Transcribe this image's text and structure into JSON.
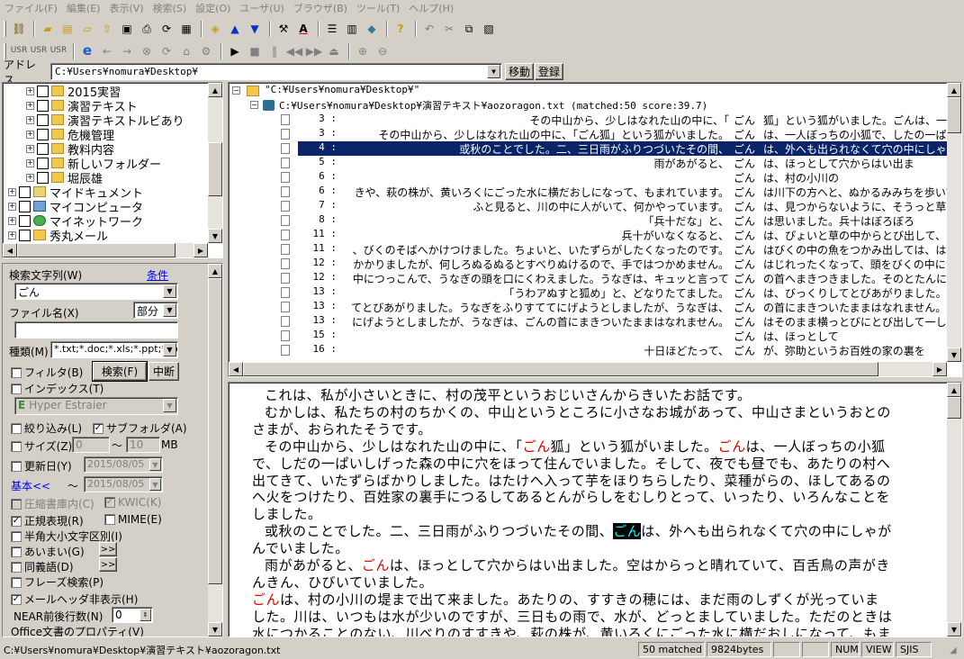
{
  "menu": [
    "ファイル(F)",
    "編集(E)",
    "表示(V)",
    "検索(S)",
    "設定(O)",
    "ユーザ(U)",
    "ブラウザ(B)",
    "ツール(T)",
    "ヘルプ(H)"
  ],
  "address": {
    "label": "アドレス",
    "value": "C:¥Users¥nomura¥Desktop¥",
    "move_label": "移動",
    "register_label": "登録"
  },
  "tree": {
    "items": [
      {
        "label": "2015実習",
        "level": 2
      },
      {
        "label": "演習テキスト",
        "level": 2
      },
      {
        "label": "演習テキストルビあり",
        "level": 2
      },
      {
        "label": "危機管理",
        "level": 2
      },
      {
        "label": "教料内容",
        "level": 2
      },
      {
        "label": "新しいフォルダー",
        "level": 2
      },
      {
        "label": "堀辰雄",
        "level": 2
      },
      {
        "label": "マイドキュメント",
        "level": 1
      },
      {
        "label": "マイコンピュータ",
        "level": 1
      },
      {
        "label": "マイネットワーク",
        "level": 1
      },
      {
        "label": "秀丸メール",
        "level": 1
      }
    ]
  },
  "search": {
    "query_label": "検索文字列(W)",
    "condition_link": "条件",
    "query_value": "ごん",
    "filename_label": "ファイル名(X)",
    "filename_mode": "部分",
    "filename_value": "",
    "type_label": "種類(M)",
    "type_value": "*.txt;*.doc;*.xls;*.ppt;*.doc",
    "filter_label": "フィルタ(B)",
    "search_button": "検索(F)",
    "stop_button": "中断",
    "index_label": "インデックス(T)",
    "engine_value": "Hyper Estraier",
    "narrow_label": "絞り込み(L)",
    "subfolder_label": "サブフォルダ(A)",
    "size_label": "サイズ(Z)",
    "size_min": "0",
    "size_tilde": "～",
    "size_max": "10",
    "size_unit": "MB",
    "date_label": "更新日(Y)",
    "date_from": "2015/08/05",
    "basic_link": "基本<<",
    "date_tilde": "～",
    "date_to": "2015/08/05",
    "archive_label": "圧縮書庫内(C)",
    "kwic_label": "KWIC(K)",
    "regex_label": "正規表現(R)",
    "mime_label": "MIME(E)",
    "halfwidth_label": "半角大小文字区別(I)",
    "fuzzy_label": "あいまい(G)",
    "synonym_label": "同義語(D)",
    "phrase_label": "フレーズ検索(P)",
    "mailhdr_label": "メールヘッダ非表示(H)",
    "near_label": "NEAR前後行数(N)",
    "near_value": "0",
    "office_label": "Office文書のプロパティ(V)",
    "more_button": ">>"
  },
  "results": {
    "root": "\"C:¥Users¥nomura¥Desktop¥\"",
    "file": "C:¥Users¥nomura¥Desktop¥演習テキスト¥aozoragon.txt (matched:50 score:39.7)",
    "rows": [
      {
        "num": "3 :",
        "before": "その中山から、少しはなれた山の中に、「",
        "kw": "ごん",
        "after": "狐」という狐がいました。ごんは、一人ぼ"
      },
      {
        "num": "3 :",
        "before": "その中山から、少しはなれた山の中に、「ごん狐」という狐がいました。",
        "kw": "ごん",
        "after": "は、一人ぼっちの小狐で、したの一ぱい"
      },
      {
        "num": "4 :",
        "before": "或秋のことでした。二、三日雨がふりつづいたその間、",
        "kw": "ごん",
        "after": "は、外へも出られなくて穴の中にしゃがん"
      },
      {
        "num": "5 :",
        "before": "雨があがると、",
        "kw": "ごん",
        "after": "は、ほっとして穴からはい出ま"
      },
      {
        "num": "6 :",
        "before": "",
        "kw": "ごん",
        "after": "は、村の小川の"
      },
      {
        "num": "6 :",
        "before": "きや、萩の株が、黄いろくにごった水に横だおしになって、もまれています。",
        "kw": "ごん",
        "after": "は川下の方へと、ぬかるみみちを歩いて"
      },
      {
        "num": "7 :",
        "before": "ふと見ると、川の中に人がいて、何かやっています。",
        "kw": "ごん",
        "after": "は、見つからないように、そうっと草の深"
      },
      {
        "num": "8 :",
        "before": "「兵十だな」と、",
        "kw": "ごん",
        "after": "は思いました。兵十はぼろぼろ"
      },
      {
        "num": "11 :",
        "before": "兵十がいなくなると、",
        "kw": "ごん",
        "after": "は、ぴょいと草の中からとび出して、"
      },
      {
        "num": "11 :",
        "before": "、びくのそばへかけつけました。ちょいと、いたずらがしたくなったのです。",
        "kw": "ごん",
        "after": "はびくの中の魚をつかみ出しては、はりき"
      },
      {
        "num": "12 :",
        "before": "かかりましたが、何しろぬるぬるとすべりぬけるので、手ではつかめません。",
        "kw": "ごん",
        "after": "はじれったくなって、頭をびくの中につっ"
      },
      {
        "num": "12 :",
        "before": "中につっこんで、うなぎの頭を口にくわえました。うなぎは、キュッと言って",
        "kw": "ごん",
        "after": "の首へまきつきました。そのとたんに兵十"
      },
      {
        "num": "13 :",
        "before": "「うわアぬすと狐め」と、どなりたてました。",
        "kw": "ごん",
        "after": "は、びっくりしてとびあがりました。うな"
      },
      {
        "num": "13 :",
        "before": "てとびあがりました。うなぎをふりすててにげようとしましたが、うなぎは、",
        "kw": "ごん",
        "after": "の首にまきついたままはなれません。ごん"
      },
      {
        "num": "13 :",
        "before": "にげようとしましたが、うなぎは、ごんの首にまきついたままはなれません。",
        "kw": "ごん",
        "after": "はそのまま横っとびにとび出して一しょう"
      },
      {
        "num": "15 :",
        "before": "",
        "kw": "ごん",
        "after": "は、ほっとして"
      },
      {
        "num": "16 :",
        "before": "十日ほどたって、",
        "kw": "ごん",
        "after": "が、弥助というお百姓の家の裏を"
      }
    ]
  },
  "preview": {
    "lines": [
      [
        {
          "t": "これは、私が小さいときに、村の茂平というおじいさんからきいたお話です。"
        }
      ],
      [
        {
          "t": "むかしは、私たちの村のちかくの、中山というところに小さなお城があって、中山さまというおとの"
        }
      ],
      [
        {
          "t": "さまが、おられたそうです。"
        }
      ],
      [
        {
          "t": "その中山から、少しはなれた山の中に、「"
        },
        {
          "t": "ごん",
          "h": 1
        },
        {
          "t": "狐」という狐がいました。"
        },
        {
          "t": "ごん",
          "h": 1
        },
        {
          "t": "は、一人ぼっちの小狐"
        }
      ],
      [
        {
          "t": "で、しだの一ぱいしげった森の中に穴をほって住んでいました。そして、夜でも昼でも、あたりの村へ"
        }
      ],
      [
        {
          "t": "出てきて、いたずらばかりしました。はたけへ入って芋をほりちらしたり、菜種がらの、ほしてあるの"
        }
      ],
      [
        {
          "t": "へ火をつけたり、百姓家の裏手につるしてあるとんがらしをむしりとって、いったり、いろんなことを"
        }
      ],
      [
        {
          "t": "しました。"
        }
      ],
      [
        {
          "t": "或秋のことでした。二、三日雨がふりつづいたその間、"
        },
        {
          "t": "ごん",
          "h": 2
        },
        {
          "t": "は、外へも出られなくて穴の中にしゃが"
        }
      ],
      [
        {
          "t": "んでいました。"
        }
      ],
      [
        {
          "t": "雨があがると、"
        },
        {
          "t": "ごん",
          "h": 1
        },
        {
          "t": "は、ほっとして穴からはい出ました。空はからっと晴れていて、百舌鳥の声がき"
        }
      ],
      [
        {
          "t": "んきん、ひびいていました。"
        }
      ],
      [
        {
          "t": "ごん",
          "h": 1
        },
        {
          "t": "は、村の小川の堤まで出て来ました。あたりの、すすきの穂には、まだ雨のしずくが光っていま"
        }
      ],
      [
        {
          "t": "した。川は、いつもは水が少いのですが、三日もの雨で、水が、どっとましていました。ただのときは"
        }
      ],
      [
        {
          "t": "水につかることのない、川べりのすすきや、萩の株が、黄いろくにごった水に横だおしになって、もま"
        }
      ]
    ]
  },
  "status": {
    "path": "C:¥Users¥nomura¥Desktop¥演習テキスト¥aozoragon.txt",
    "matched": "50 matched",
    "bytes": "9824bytes",
    "num": "NUM",
    "view": "VIEW",
    "encoding": "SJIS"
  }
}
